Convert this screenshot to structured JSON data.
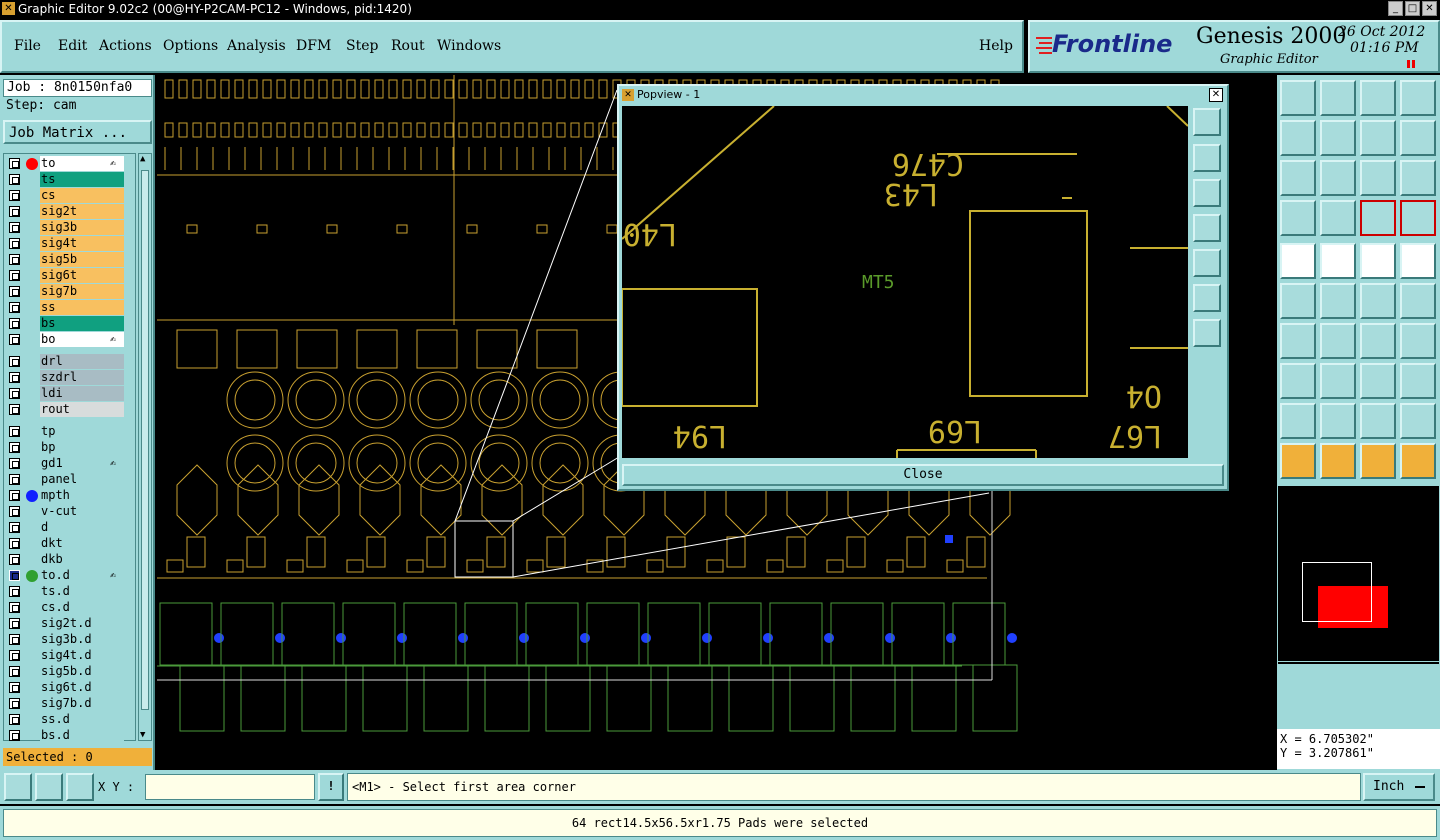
{
  "window": {
    "title": "Graphic Editor 9.02c2 (00@HY-P2CAM-PC12 - Windows, pid:1420)"
  },
  "menu": [
    "File",
    "Edit",
    "Actions",
    "Options",
    "Analysis",
    "DFM",
    "Step",
    "Rout",
    "Windows"
  ],
  "help_label": "Help",
  "brand": {
    "logo": "Frontline",
    "product": "Genesis 2000",
    "subtitle": "Graphic Editor",
    "date": "26 Oct 2012",
    "time": "01:16 PM"
  },
  "job": {
    "label": "Job : 8n0150nfa0",
    "step": "Step: cam",
    "matrix_button": "Job Matrix ..."
  },
  "layers": [
    {
      "name": "to",
      "color": "#ffffff",
      "dot": "#ff0000",
      "flag": "✍"
    },
    {
      "name": "ts",
      "color": "#10a080"
    },
    {
      "name": "cs",
      "color": "#f8c060"
    },
    {
      "name": "sig2t",
      "color": "#f8c060"
    },
    {
      "name": "sig3b",
      "color": "#f8c060"
    },
    {
      "name": "sig4t",
      "color": "#f8c060"
    },
    {
      "name": "sig5b",
      "color": "#f8c060"
    },
    {
      "name": "sig6t",
      "color": "#f8c060"
    },
    {
      "name": "sig7b",
      "color": "#f8c060"
    },
    {
      "name": "ss",
      "color": "#f8c060"
    },
    {
      "name": "bs",
      "color": "#10a080"
    },
    {
      "name": "bo",
      "color": "#ffffff",
      "flag": "✍"
    },
    {
      "name": "drl",
      "color": "#a8bcc4"
    },
    {
      "name": "szdrl",
      "color": "#a8bcc4"
    },
    {
      "name": "ldi",
      "color": "#a8bcc4"
    },
    {
      "name": "rout",
      "color": "#d8dcdc"
    },
    {
      "name": "tp",
      "color": "#9fd9d9"
    },
    {
      "name": "bp",
      "color": "#9fd9d9"
    },
    {
      "name": "gd1",
      "color": "#9fd9d9",
      "flag": "✍"
    },
    {
      "name": "panel",
      "color": "#9fd9d9"
    },
    {
      "name": "mpth",
      "color": "#9fd9d9",
      "dot": "#1020ff"
    },
    {
      "name": "v-cut",
      "color": "#9fd9d9"
    },
    {
      "name": "d",
      "color": "#9fd9d9"
    },
    {
      "name": "dkt",
      "color": "#9fd9d9"
    },
    {
      "name": "dkb",
      "color": "#9fd9d9"
    },
    {
      "name": "to.d",
      "color": "#9fd9d9",
      "dot": "#30a030",
      "flag": "✍ ⊞",
      "work": true
    },
    {
      "name": "ts.d",
      "color": "#9fd9d9"
    },
    {
      "name": "cs.d",
      "color": "#9fd9d9"
    },
    {
      "name": "sig2t.d",
      "color": "#9fd9d9"
    },
    {
      "name": "sig3b.d",
      "color": "#9fd9d9"
    },
    {
      "name": "sig4t.d",
      "color": "#9fd9d9"
    },
    {
      "name": "sig5b.d",
      "color": "#9fd9d9"
    },
    {
      "name": "sig6t.d",
      "color": "#9fd9d9"
    },
    {
      "name": "sig7b.d",
      "color": "#9fd9d9"
    },
    {
      "name": "ss.d",
      "color": "#9fd9d9"
    },
    {
      "name": "bs.d",
      "color": "#9fd9d9"
    }
  ],
  "selected": "Selected : 0",
  "popview": {
    "title": "Popview - 1",
    "close_label": "Close",
    "labels": {
      "c476": "C476",
      "l43": "L43",
      "l40": "L40",
      "mt5": "MT5",
      "l69": "L69",
      "l94": "L94",
      "l67": "L67",
      "o4": "O4"
    }
  },
  "coords": {
    "x": "X = 6.705302\"",
    "y": "Y = 3.207861\""
  },
  "xy_label": "X Y :",
  "xy_value": "",
  "prompt": "<M1> - Select first area corner",
  "units": "Inch",
  "message": "64 rect14.5x56.5xr1.75 Pads were selected"
}
